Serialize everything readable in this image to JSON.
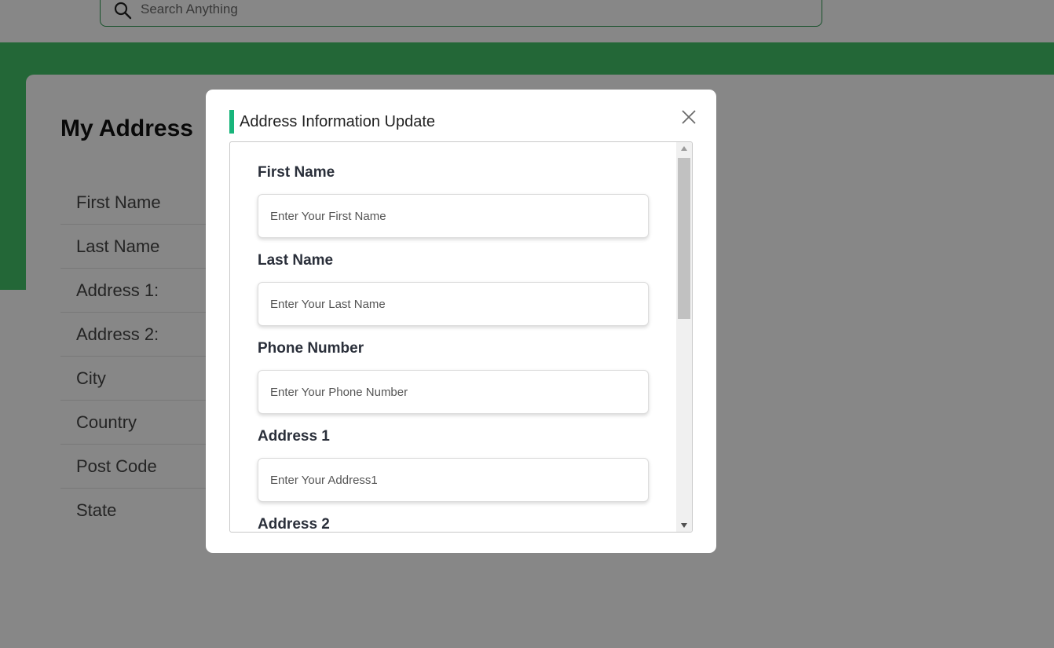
{
  "search": {
    "placeholder": "Search Anything",
    "icon": "search-icon"
  },
  "page": {
    "title": "My Address",
    "address_labels": [
      "First Name",
      "Last Name",
      "Address 1:",
      "Address 2:",
      "City",
      "Country",
      "Post Code",
      "State"
    ]
  },
  "modal": {
    "title": "Address Information Update",
    "close_icon": "close-icon",
    "fields": [
      {
        "label": "First Name",
        "placeholder": "Enter Your First Name",
        "value": ""
      },
      {
        "label": "Last Name",
        "placeholder": "Enter Your Last Name",
        "value": ""
      },
      {
        "label": "Phone Number",
        "placeholder": "Enter Your Phone Number",
        "value": ""
      },
      {
        "label": "Address 1",
        "placeholder": "Enter Your Address1",
        "value": ""
      },
      {
        "label": "Address 2"
      }
    ]
  },
  "colors": {
    "brand_green": "#43c268",
    "accent_teal": "#18b57b",
    "search_border": "#2e9a52"
  }
}
